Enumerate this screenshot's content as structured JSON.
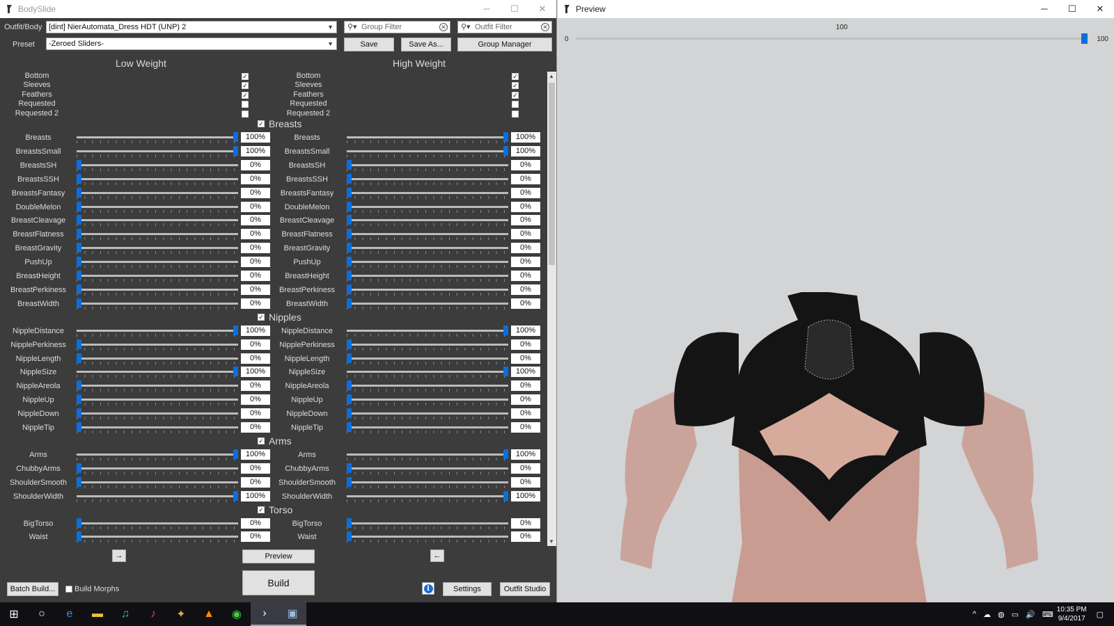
{
  "bodyslide": {
    "title": "BodySlide",
    "outfit_label": "Outfit/Body",
    "outfit_value": "[dint] NierAutomata_Dress HDT (UNP) 2",
    "preset_label": "Preset",
    "preset_value": "-Zeroed Sliders-",
    "group_filter_placeholder": "Group Filter",
    "outfit_filter_placeholder": "Outfit Filter",
    "save_label": "Save",
    "save_as_label": "Save As...",
    "group_manager_label": "Group Manager",
    "low_weight": "Low Weight",
    "high_weight": "High Weight",
    "zap_options": [
      {
        "name": "Bottom",
        "low": true,
        "high": true
      },
      {
        "name": "Sleeves",
        "low": true,
        "high": true
      },
      {
        "name": "Feathers",
        "low": true,
        "high": true
      },
      {
        "name": "Requested",
        "low": false,
        "high": false
      },
      {
        "name": "Requested 2",
        "low": false,
        "high": false
      }
    ],
    "sections": [
      {
        "name": "Breasts",
        "sliders": [
          {
            "name": "Breasts",
            "low": 100,
            "high": 100
          },
          {
            "name": "BreastsSmall",
            "low": 100,
            "high": 100
          },
          {
            "name": "BreastsSH",
            "low": 0,
            "high": 0
          },
          {
            "name": "BreastsSSH",
            "low": 0,
            "high": 0
          },
          {
            "name": "BreastsFantasy",
            "low": 0,
            "high": 0
          },
          {
            "name": "DoubleMelon",
            "low": 0,
            "high": 0
          },
          {
            "name": "BreastCleavage",
            "low": 0,
            "high": 0
          },
          {
            "name": "BreastFlatness",
            "low": 0,
            "high": 0
          },
          {
            "name": "BreastGravity",
            "low": 0,
            "high": 0
          },
          {
            "name": "PushUp",
            "low": 0,
            "high": 0
          },
          {
            "name": "BreastHeight",
            "low": 0,
            "high": 0
          },
          {
            "name": "BreastPerkiness",
            "low": 0,
            "high": 0
          },
          {
            "name": "BreastWidth",
            "low": 0,
            "high": 0
          }
        ]
      },
      {
        "name": "Nipples",
        "sliders": [
          {
            "name": "NippleDistance",
            "low": 100,
            "high": 100
          },
          {
            "name": "NipplePerkiness",
            "low": 0,
            "high": 0
          },
          {
            "name": "NippleLength",
            "low": 0,
            "high": 0
          },
          {
            "name": "NippleSize",
            "low": 100,
            "high": 100
          },
          {
            "name": "NippleAreola",
            "low": 0,
            "high": 0
          },
          {
            "name": "NippleUp",
            "low": 0,
            "high": 0
          },
          {
            "name": "NippleDown",
            "low": 0,
            "high": 0
          },
          {
            "name": "NippleTip",
            "low": 0,
            "high": 0
          }
        ]
      },
      {
        "name": "Arms",
        "sliders": [
          {
            "name": "Arms",
            "low": 100,
            "high": 100
          },
          {
            "name": "ChubbyArms",
            "low": 0,
            "high": 0
          },
          {
            "name": "ShoulderSmooth",
            "low": 0,
            "high": 0
          },
          {
            "name": "ShoulderWidth",
            "low": 100,
            "high": 100
          }
        ]
      },
      {
        "name": "Torso",
        "sliders": [
          {
            "name": "BigTorso",
            "low": 0,
            "high": 0
          },
          {
            "name": "Waist",
            "low": 0,
            "high": 0
          }
        ]
      }
    ],
    "arrow_right": "→",
    "arrow_left": "←",
    "preview_label": "Preview",
    "build_label": "Build",
    "batch_build_label": "Batch Build...",
    "build_morphs_label": "Build Morphs",
    "build_morphs_checked": false,
    "settings_label": "Settings",
    "outfit_studio_label": "Outfit Studio",
    "accent": "#0a6fdc"
  },
  "preview": {
    "title": "Preview",
    "weight_min": "0",
    "weight_max": "100",
    "weight_value": "100",
    "weight_fraction": 1.0
  },
  "taskbar": {
    "time": "10:35 PM",
    "date": "9/4/2017",
    "icons": [
      "windows-icon",
      "cortana-icon",
      "edge-icon",
      "explorer-icon",
      "music-icon",
      "itunes-icon",
      "game-icon",
      "vlc-icon",
      "chrome-icon",
      "bodyslide-icon",
      "outfitstudio-icon"
    ]
  }
}
